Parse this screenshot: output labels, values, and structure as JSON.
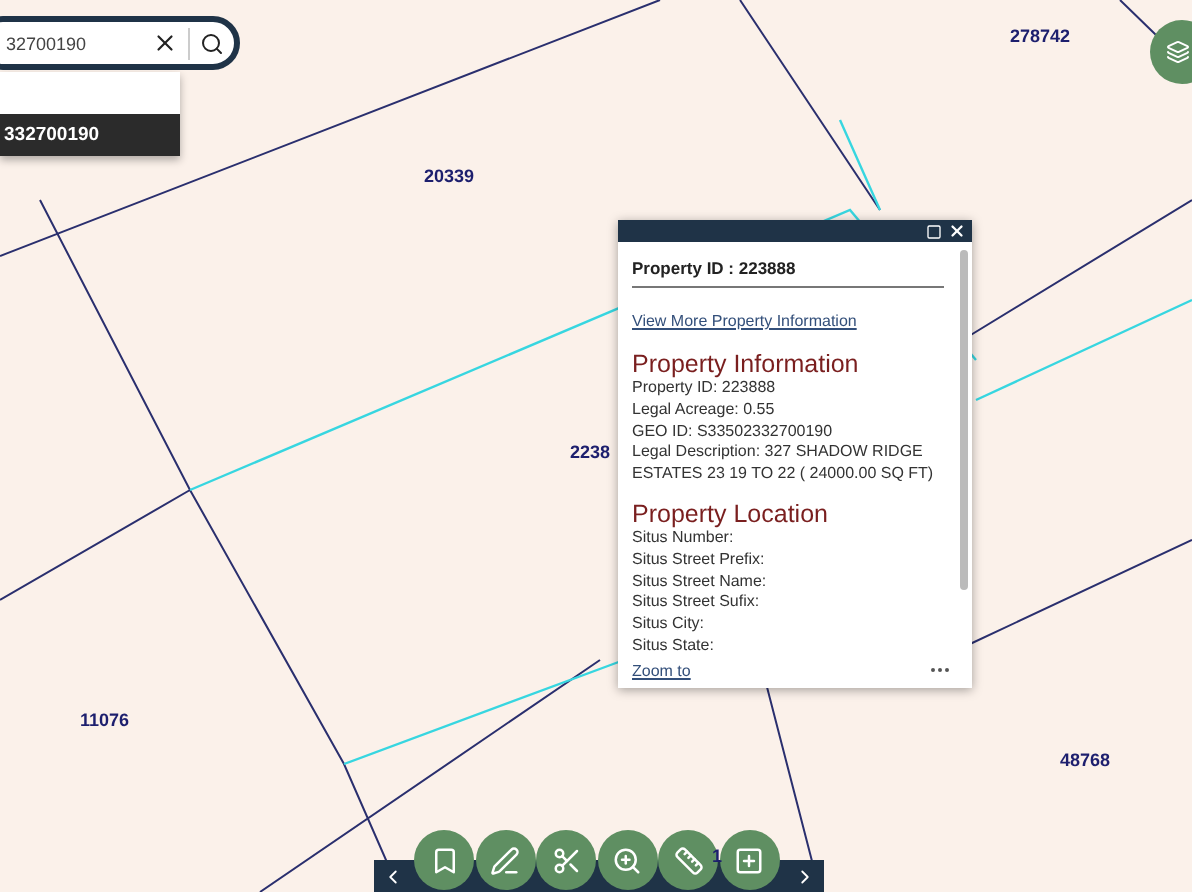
{
  "map": {
    "parcel_labels": [
      "278742",
      "20339",
      "2238",
      "11076",
      "48768",
      "1"
    ]
  },
  "search": {
    "value": "32700190",
    "suggestions": [
      {
        "text": "332700190",
        "selected": true
      }
    ]
  },
  "popup": {
    "title": "Property ID : 223888",
    "link": "View More Property Information",
    "sections": [
      {
        "heading": "Property Information",
        "lines": [
          "Property ID: 223888",
          "Legal Acreage: 0.55",
          "GEO ID: S33502332700190",
          "Legal Description: 327 SHADOW RIDGE ESTATES 23 19 TO 22 ( 24000.00 SQ FT)"
        ]
      },
      {
        "heading": "Property Location",
        "lines": [
          "Situs Number:",
          "Situs Street Prefix:",
          "Situs Street Name:",
          "Situs Street Sufix:",
          "Situs City:",
          "Situs State:"
        ]
      }
    ],
    "footer_link": "Zoom to"
  }
}
